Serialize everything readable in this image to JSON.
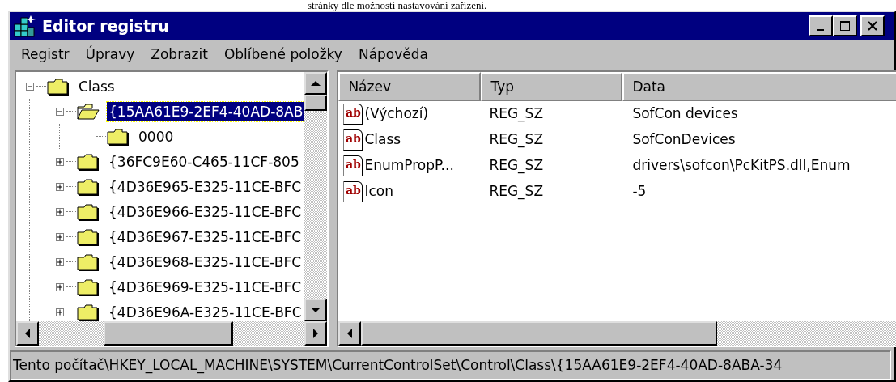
{
  "background_text": "stránky dle možností nastavování zařízení.",
  "window": {
    "title": "Editor registru"
  },
  "menu": [
    {
      "label": "Registr"
    },
    {
      "label": "Úpravy"
    },
    {
      "label": "Zobrazit"
    },
    {
      "label": "Oblíbené položky"
    },
    {
      "label": "Nápověda"
    }
  ],
  "tree": [
    {
      "label": "Class",
      "expandable": true,
      "expanded": true,
      "selected": false,
      "children": [
        {
          "label": "{15AA61E9-2EF4-40AD-8AB",
          "expandable": true,
          "expanded": true,
          "selected": true,
          "children": [
            {
              "label": "0000",
              "expandable": false,
              "selected": false
            }
          ]
        },
        {
          "label": "{36FC9E60-C465-11CF-805",
          "expandable": true,
          "expanded": false,
          "selected": false
        },
        {
          "label": "{4D36E965-E325-11CE-BFC",
          "expandable": true,
          "expanded": false,
          "selected": false
        },
        {
          "label": "{4D36E966-E325-11CE-BFC",
          "expandable": true,
          "expanded": false,
          "selected": false
        },
        {
          "label": "{4D36E967-E325-11CE-BFC",
          "expandable": true,
          "expanded": false,
          "selected": false
        },
        {
          "label": "{4D36E968-E325-11CE-BFC",
          "expandable": true,
          "expanded": false,
          "selected": false
        },
        {
          "label": "{4D36E969-E325-11CE-BFC",
          "expandable": true,
          "expanded": false,
          "selected": false
        },
        {
          "label": "{4D36E96A-E325-11CE-BFC",
          "expandable": true,
          "expanded": false,
          "selected": false
        }
      ]
    }
  ],
  "values": {
    "columns": [
      "Název",
      "Typ",
      "Data"
    ],
    "rows": [
      {
        "icon": "ab",
        "name": "(Výchozí)",
        "type": "REG_SZ",
        "data": "SofCon devices"
      },
      {
        "icon": "ab",
        "name": "Class",
        "type": "REG_SZ",
        "data": "SofConDevices"
      },
      {
        "icon": "ab",
        "name": "EnumPropP...",
        "type": "REG_SZ",
        "data": "drivers\\sofcon\\PcKitPS.dll,Enum"
      },
      {
        "icon": "ab",
        "name": "Icon",
        "type": "REG_SZ",
        "data": "-5"
      }
    ]
  },
  "status_bar": "Tento počítač\\HKEY_LOCAL_MACHINE\\SYSTEM\\CurrentControlSet\\Control\\Class\\{15AA61E9-2EF4-40AD-8ABA-34"
}
